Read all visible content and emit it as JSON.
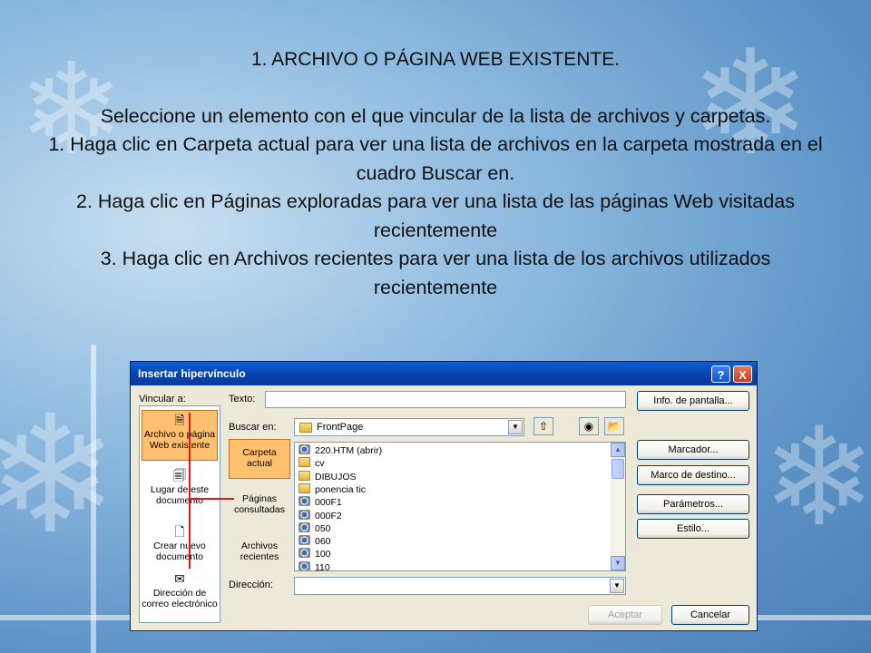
{
  "slide": {
    "heading": "1. ARCHIVO O PÁGINA WEB EXISTENTE.",
    "lines": [
      "Seleccione un elemento con el que vincular de la lista de archivos y carpetas.",
      "1. Haga clic en Carpeta actual para ver una lista de archivos en la carpeta mostrada en el cuadro Buscar en.",
      "2. Haga clic en Páginas exploradas para ver una lista de las páginas Web visitadas recientemente",
      "3. Haga clic en Archivos recientes para ver una lista de los archivos utilizados recientemente"
    ]
  },
  "dialog": {
    "title": "Insertar hipervínculo",
    "help_button": "?",
    "close_button": "X",
    "link_to_label": "Vincular a:",
    "text_label": "Texto:",
    "text_value": "",
    "screen_tip_button": "Info. de pantalla...",
    "look_in_label": "Buscar en:",
    "look_in_value": "FrontPage",
    "places": [
      {
        "label": "Archivo o página Web existente",
        "icon": "existing-file-icon"
      },
      {
        "label": "Lugar de este documento",
        "icon": "place-in-document-icon"
      },
      {
        "label": "Crear nuevo documento",
        "icon": "new-document-icon"
      },
      {
        "label": "Dirección de correo electrónico",
        "icon": "email-icon"
      }
    ],
    "sub_options": [
      {
        "label": "Carpeta actual"
      },
      {
        "label": "Páginas consultadas"
      },
      {
        "label": "Archivos recientes"
      }
    ],
    "files": [
      {
        "name": "220.HTM (abrir)",
        "type": "htm"
      },
      {
        "name": "cv",
        "type": "folder"
      },
      {
        "name": "DIBUJOS",
        "type": "folder"
      },
      {
        "name": "ponencia tic",
        "type": "folder"
      },
      {
        "name": "000F1",
        "type": "htm"
      },
      {
        "name": "000F2",
        "type": "htm"
      },
      {
        "name": "050",
        "type": "htm"
      },
      {
        "name": "060",
        "type": "htm"
      },
      {
        "name": "100",
        "type": "htm"
      },
      {
        "name": "110",
        "type": "htm"
      }
    ],
    "right_buttons": [
      "Marcador...",
      "Marco de destino...",
      "Parámetros...",
      "Estilo..."
    ],
    "address_label": "Dirección:",
    "address_value": "",
    "ok_button": "Aceptar",
    "cancel_button": "Cancelar"
  },
  "colors": {
    "selected_place": "#ffc070",
    "annotation_line": "#e01818",
    "titlebar": "#0a5fd8"
  }
}
